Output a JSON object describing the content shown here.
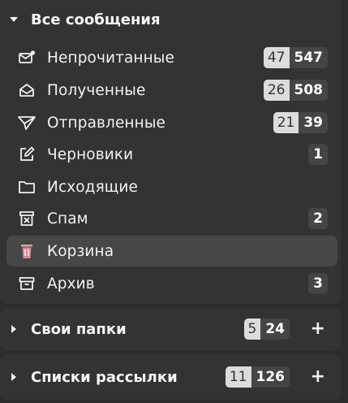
{
  "all_messages": {
    "title": "Все сообщения",
    "items": [
      {
        "label": "Непрочитанные",
        "icon": "envelope-unread-icon",
        "unread": "47",
        "total": "547"
      },
      {
        "label": "Полученные",
        "icon": "envelope-open-icon",
        "unread": "26",
        "total": "508"
      },
      {
        "label": "Отправленные",
        "icon": "paper-plane-icon",
        "unread": "21",
        "total": "39"
      },
      {
        "label": "Черновики",
        "icon": "pencil-square-icon",
        "unread": "",
        "total": "1"
      },
      {
        "label": "Исходящие",
        "icon": "folder-icon",
        "unread": "",
        "total": ""
      },
      {
        "label": "Спам",
        "icon": "spam-box-icon",
        "unread": "",
        "total": "2"
      },
      {
        "label": "Корзина",
        "icon": "trash-icon",
        "unread": "",
        "total": ""
      },
      {
        "label": "Архив",
        "icon": "archive-icon",
        "unread": "",
        "total": "3"
      }
    ]
  },
  "my_folders": {
    "title": "Свои папки",
    "unread": "5",
    "total": "24",
    "add": "+"
  },
  "mailing_lists": {
    "title": "Списки рассылки",
    "unread": "11",
    "total": "126",
    "add": "+"
  },
  "colors": {
    "background": "#2c2c2c",
    "group": "#333333",
    "active_row": "#474747",
    "trash_accent": "#e8a0a8"
  }
}
